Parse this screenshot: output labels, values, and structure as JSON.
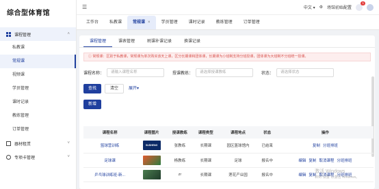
{
  "app": {
    "title": "综合型体育馆"
  },
  "sidebar": {
    "groups": [
      {
        "label": "课程管理",
        "expanded": true,
        "items": [
          {
            "label": "私教课"
          },
          {
            "label": "常规课",
            "active": true
          },
          {
            "label": "视频课"
          },
          {
            "label": "学员管理"
          },
          {
            "label": "课时记录"
          },
          {
            "label": "教练管理"
          },
          {
            "label": "订单管理"
          }
        ]
      },
      {
        "label": "器材租赁"
      },
      {
        "label": "专项卡管理"
      }
    ]
  },
  "topbar": {
    "lang": "中文",
    "lang_chevron": "▾",
    "settings_label": "场馆初始配置",
    "notification_count": "1"
  },
  "tabs": [
    {
      "label": "工作台"
    },
    {
      "label": "私教课"
    },
    {
      "label": "常规课",
      "active": true,
      "close": "×"
    },
    {
      "label": "学员管理"
    },
    {
      "label": "课时记录"
    },
    {
      "label": "教练管理"
    },
    {
      "label": "订单管理"
    }
  ],
  "subtabs": [
    {
      "label": "课程管理",
      "active": true
    },
    {
      "label": "课表管理"
    },
    {
      "label": "刷课补课记录"
    },
    {
      "label": "换课记录"
    }
  ],
  "alert": "常规课：区别于私教课，常规课为单次购买该天上课，区分长期课和团体课，长期课为小班制支持分班授课，团体课为大班制不分班统一授课。",
  "filters": {
    "course_name_label": "课程名称：",
    "course_name_placeholder": "请输入课程名称",
    "coach_label": "授课教练：",
    "coach_placeholder": "请选择授课教练",
    "status_label": "状态：",
    "status_placeholder": "请选择状态"
  },
  "buttons": {
    "search": "查找",
    "clear": "清空",
    "expand": "展开▾",
    "add": "新增"
  },
  "table": {
    "columns": [
      "课程名称",
      "课程图片",
      "授课教练",
      "课程类型",
      "课程地点",
      "状态",
      "操作"
    ],
    "rows": [
      {
        "name": "篮球营训练",
        "coach": "张教练",
        "type": "长期课",
        "place": "园区篮球馆内",
        "status": "已结束",
        "ops": [
          "复制",
          "分班排班"
        ],
        "img_color": "#0c2a66",
        "img_text": "SUSHENG"
      },
      {
        "name": "足球课",
        "coach": "杨教练",
        "type": "长期课",
        "place": "足球",
        "status": "报名中",
        "ops": [
          "编辑",
          "复制",
          "取消课程",
          "分班排班"
        ],
        "img_color": "#d64a2c",
        "img_text": ""
      },
      {
        "name": "乒乓球训练班-新...",
        "coach": "zr",
        "type": "长期课",
        "place": "莲花产业园",
        "status": "报名中",
        "ops": [
          "编辑",
          "复制",
          "取消课程",
          "分班排班"
        ],
        "img_color": "#3b6b3f",
        "img_text": ""
      }
    ]
  },
  "watermark": {
    "line1": "激活 Windows",
    "line2": "转到\"设置\"以激活 Windows。"
  }
}
